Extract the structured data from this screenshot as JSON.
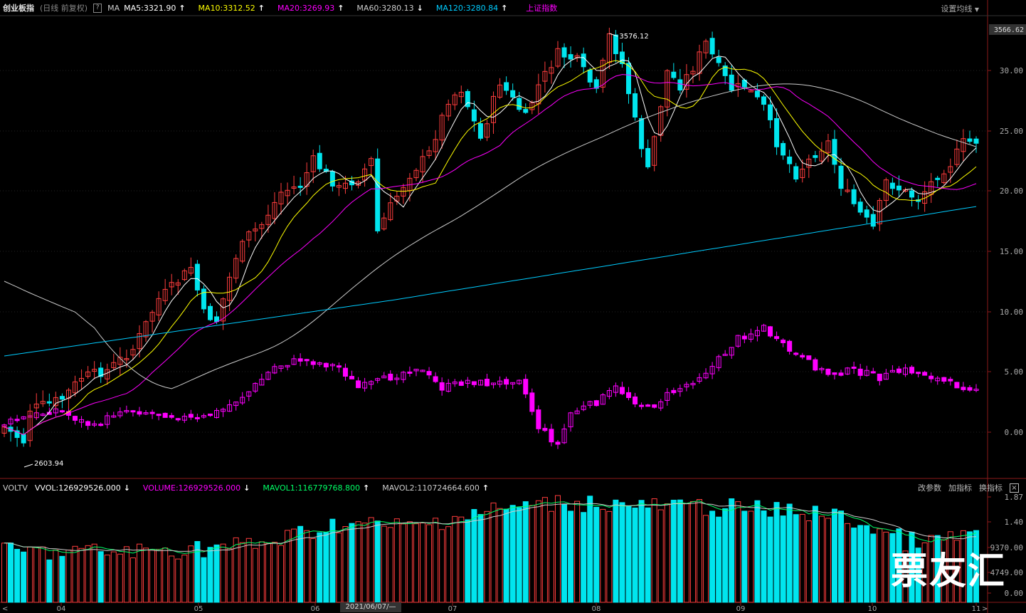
{
  "header": {
    "name": "创业板指",
    "period": "(日线 前复权)",
    "help": "?",
    "ma_label": "MA",
    "ma": [
      {
        "label": "MA5:3321.90",
        "color": "#ffffff",
        "arrow": "↑"
      },
      {
        "label": "MA10:3312.52",
        "color": "#ffff00",
        "arrow": "↑"
      },
      {
        "label": "MA20:3269.93",
        "color": "#ff00ff",
        "arrow": "↑"
      },
      {
        "label": "MA60:3280.13",
        "color": "#cccccc",
        "arrow": "↓"
      },
      {
        "label": "MA120:3280.84",
        "color": "#00ccff",
        "arrow": "↑"
      }
    ],
    "overlay": "上证指数",
    "settings": "设置均线"
  },
  "volume_header": {
    "name": "VOLTV",
    "items": [
      {
        "label": "VVOL:126929526.000",
        "color": "#ffffff",
        "arrow": "↓"
      },
      {
        "label": "VOLUME:126929526.000",
        "color": "#ff00ff",
        "arrow": "↓"
      },
      {
        "label": "MAVOL1:116779768.800",
        "color": "#00ff66",
        "arrow": "↑"
      },
      {
        "label": "MAVOL2:110724664.600",
        "color": "#cccccc",
        "arrow": "↑"
      }
    ],
    "tools": [
      "改参数",
      "加指标",
      "换指标"
    ],
    "close": "×"
  },
  "price_axis": {
    "current": "3566.62",
    "ticks": [
      "30.00",
      "25.00",
      "20.00",
      "15.00",
      "10.00",
      "5.00",
      "0.00"
    ]
  },
  "volume_axis": {
    "ticks": [
      "1.87",
      "1.40",
      "9370.00",
      "4749.00",
      "0.00"
    ]
  },
  "time_axis": {
    "months": [
      "04",
      "05",
      "06",
      "07",
      "08",
      "09",
      "10",
      "11"
    ],
    "cursor_date": "2021/06/07/—"
  },
  "annotations": {
    "high": "3576.12",
    "low": "2603.94"
  },
  "watermark": "票友汇",
  "colors": {
    "up": "#ff3d3d",
    "down": "#00e5ee",
    "ma5": "#ffffff",
    "ma10": "#ffff00",
    "ma20": "#ff00ff",
    "ma60": "#cccccc",
    "ma120": "#00ccff",
    "overlay": "#ff00ff"
  }
}
